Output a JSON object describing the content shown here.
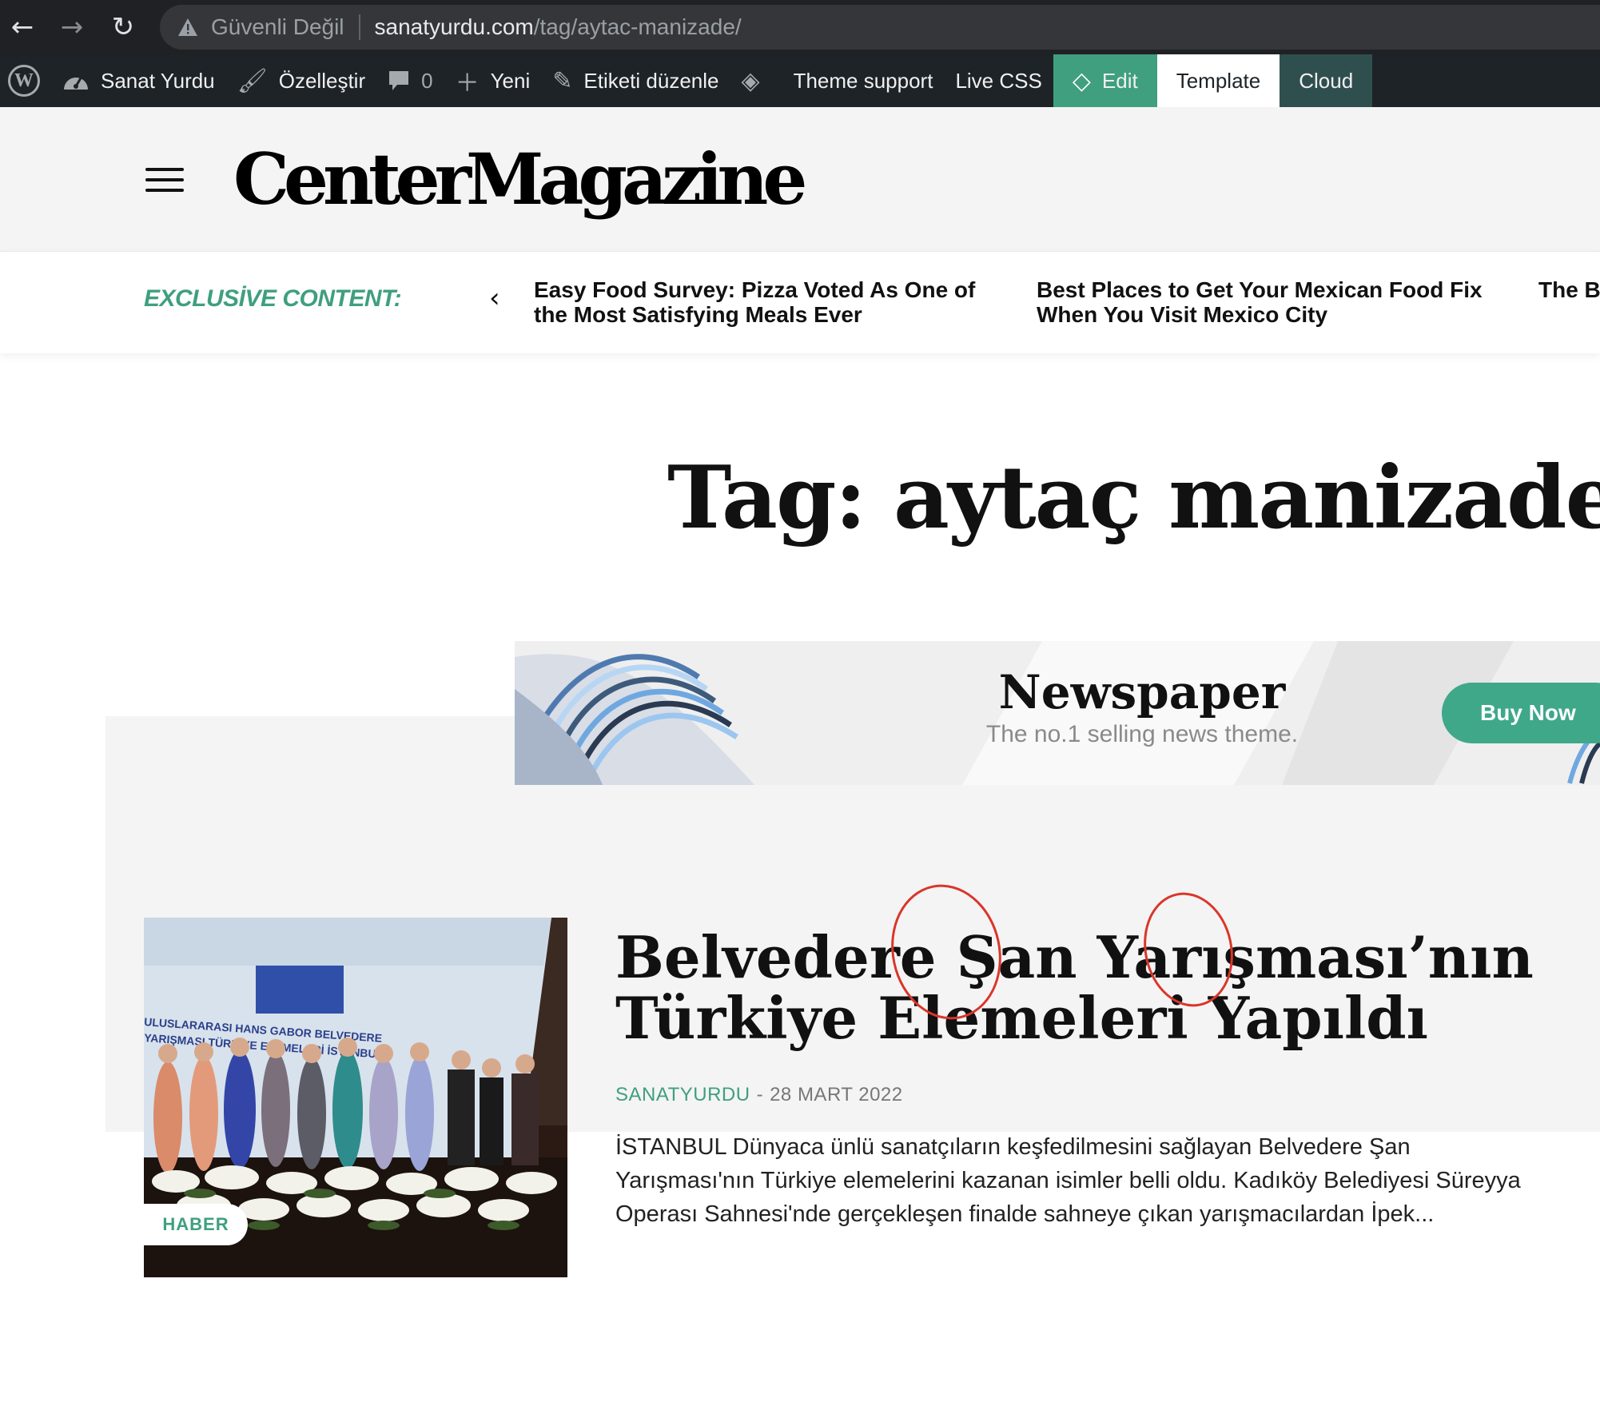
{
  "browser": {
    "security_label": "Güvenli Değil",
    "url_domain": "sanatyurdu.com",
    "url_path": "/tag/aytac-manizade/"
  },
  "admin_bar": {
    "site_name": "Sanat Yurdu",
    "customize": "Özelleştir",
    "comments_count": "0",
    "new": "Yeni",
    "edit_tag": "Etiketi düzenle",
    "theme_support": "Theme support",
    "live_css": "Live CSS",
    "edit": "Edit",
    "template": "Template",
    "cloud": "Cloud"
  },
  "header": {
    "logo": "CenterMagazine"
  },
  "exclusive": {
    "label": "EXCLUSİVE CONTENT:",
    "items": [
      "Easy Food Survey: Pizza Voted As One of the Most Satisfying Meals Ever",
      "Best Places to Get Your Mexican Food Fix When You Visit Mexico City",
      "The Best Places to Find the Ju"
    ]
  },
  "page": {
    "tag_title": "Tag: aytaç manizade"
  },
  "ad": {
    "title": "Newspaper",
    "subtitle": "The no.1 selling news theme.",
    "button": "Buy Now"
  },
  "article": {
    "category": "HABER",
    "title": "Belvedere Şan Yarışması’nın Türkiye Elemeleri Yapıldı",
    "author": "SANATYURDU",
    "separator": "-",
    "date": "28 MART 2022",
    "excerpt": "İSTANBUL Dünyaca ünlü sanatçıların keşfedilmesini sağlayan Belvedere Şan Yarışması'nın Türkiye elemelerini kazanan isimler belli oldu. Kadıköy Belediyesi Süreyya Operası Sahnesi'nde gerçekleşen finalde sahneye çıkan yarışmacılardan İpek...",
    "image_text": {
      "banner_line1": "ULUSLARARASI HANS GABOR BELVEDERE",
      "banner_line2": "YARIŞMASI TÜRKİYE ELEMELERİ İSTANBUL"
    }
  },
  "colors": {
    "accent": "#3f9f7f",
    "admin_bar": "#1d2327",
    "annotation_circle": "#d9362b"
  }
}
